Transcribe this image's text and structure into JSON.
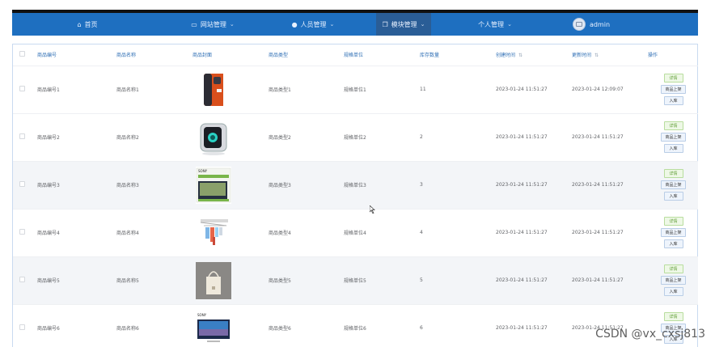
{
  "nav": {
    "home": "首页",
    "site_mgmt": "网站管理",
    "people_mgmt": "人员管理",
    "module_mgmt": "模块管理",
    "personal_mgmt": "个人管理",
    "user": "admin"
  },
  "table": {
    "headers": {
      "code": "商品编号",
      "name": "商品名称",
      "cover": "商品封面",
      "type": "商品类型",
      "unit": "规格单位",
      "stock": "库存数量",
      "created": "创建时间",
      "updated": "更新时间",
      "ops": "操作"
    },
    "rows": [
      {
        "code": "商品编号1",
        "name": "商品名称1",
        "type": "商品类型1",
        "unit": "规格单位1",
        "stock": "11",
        "created": "2023-01-24 11:51:27",
        "updated": "2023-01-24 12:09:07"
      },
      {
        "code": "商品编号2",
        "name": "商品名称2",
        "type": "商品类型2",
        "unit": "规格单位2",
        "stock": "2",
        "created": "2023-01-24 11:51:27",
        "updated": "2023-01-24 11:51:27"
      },
      {
        "code": "商品编号3",
        "name": "商品名称3",
        "type": "商品类型3",
        "unit": "规格单位3",
        "stock": "3",
        "created": "2023-01-24 11:51:27",
        "updated": "2023-01-24 11:51:27"
      },
      {
        "code": "商品编号4",
        "name": "商品名称4",
        "type": "商品类型4",
        "unit": "规格单位4",
        "stock": "4",
        "created": "2023-01-24 11:51:27",
        "updated": "2023-01-24 11:51:27"
      },
      {
        "code": "商品编号5",
        "name": "商品名称5",
        "type": "商品类型5",
        "unit": "规格单位5",
        "stock": "5",
        "created": "2023-01-24 11:51:27",
        "updated": "2023-01-24 11:51:27"
      },
      {
        "code": "商品编号6",
        "name": "商品名称6",
        "type": "商品类型6",
        "unit": "规格单位6",
        "stock": "6",
        "created": "2023-01-24 11:51:27",
        "updated": "2023-01-24 11:51:27"
      }
    ],
    "op_labels": {
      "detail": "详情",
      "shelve": "商品上架",
      "inbound": "入库"
    }
  },
  "watermark": "CSDN @vx_cxsj813",
  "colors": {
    "nav_bg": "#1e6fc0",
    "nav_active": "#2a5d96",
    "header_text": "#2f6fb5"
  },
  "icons": {
    "home": "home-icon",
    "site": "monitor-icon",
    "people": "user-icon",
    "module": "copy-icon",
    "dropdown": "chevron-down-icon"
  }
}
